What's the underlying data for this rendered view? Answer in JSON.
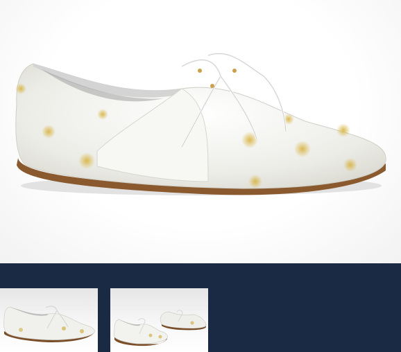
{
  "product": {
    "image_subject": "shoe-icon"
  },
  "gallery": {
    "thumbnails": [
      {
        "icon": "shoe-icon",
        "selected": true
      },
      {
        "icon": "shoe-pair-icon",
        "selected": false
      }
    ]
  },
  "colors": {
    "thumb_strip_bg": "#1b2a44",
    "shoe_body": "#f1f1ee",
    "sole": "#8a5a2e",
    "gold_accent": "#c9a642"
  }
}
